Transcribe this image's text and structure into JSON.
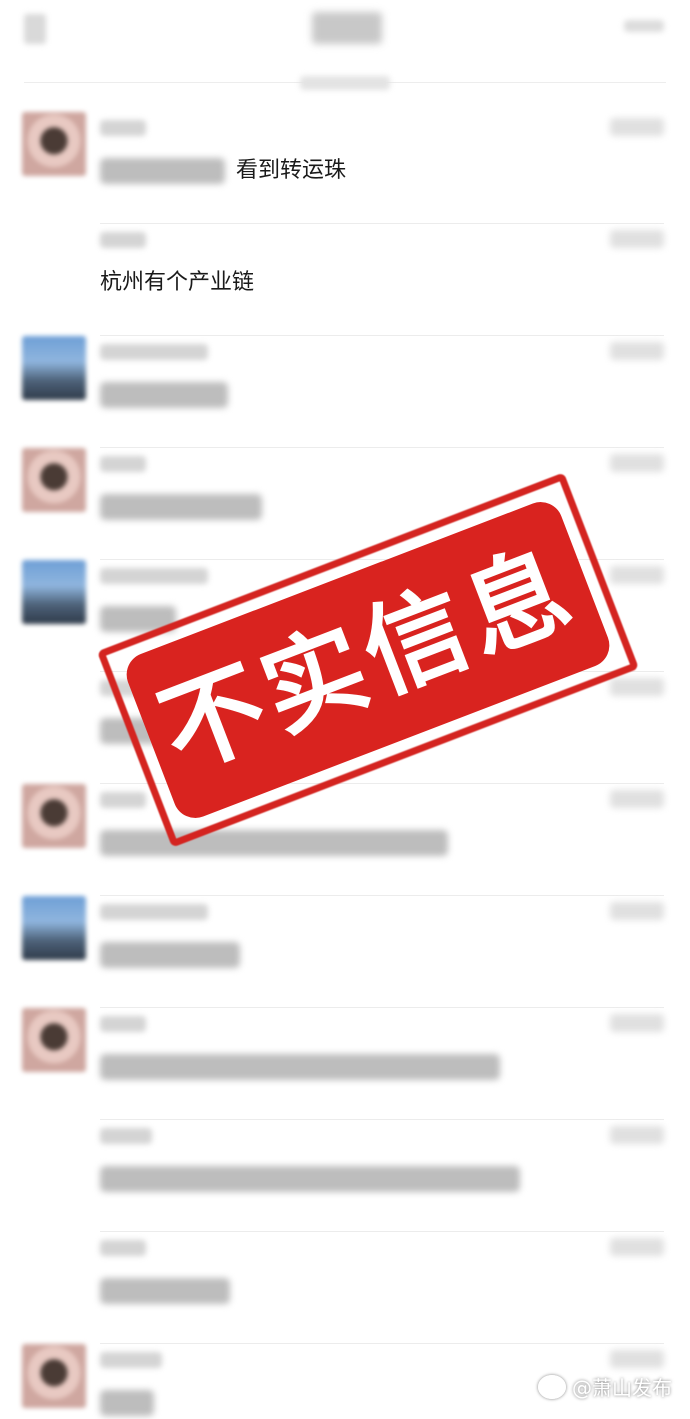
{
  "messages": [
    {
      "text_visible": "看到转运珠"
    },
    {
      "text_visible": "杭州有个产业链"
    }
  ],
  "stamp": {
    "text": "不实信息",
    "color": "#d9231f"
  },
  "watermark": {
    "text": "@萧山发布",
    "icon": "weibo-icon"
  }
}
